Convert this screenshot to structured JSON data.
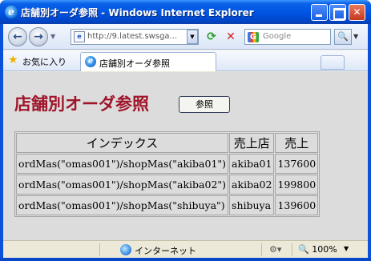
{
  "window": {
    "title": "店舗別オーダ参照 - Windows Internet Explorer"
  },
  "navbar": {
    "address": "http://9.latest.swsga...",
    "search_placeholder": "Google"
  },
  "favorites": {
    "label": "お気に入り"
  },
  "tab": {
    "label": "店舗別オーダ参照"
  },
  "page": {
    "title": "店舗別オーダ参照",
    "view_button": "参照"
  },
  "table": {
    "headers": [
      "インデックス",
      "売上店",
      "売上"
    ],
    "rows": [
      [
        "ordMas(\"omas001\")/shopMas(\"akiba01\")",
        "akiba01",
        "137600"
      ],
      [
        "ordMas(\"omas001\")/shopMas(\"akiba02\")",
        "akiba02",
        "199800"
      ],
      [
        "ordMas(\"omas001\")/shopMas(\"shibuya\")",
        "shibuya",
        "139600"
      ]
    ]
  },
  "statusbar": {
    "zone": "インターネット",
    "zoom": "100%"
  },
  "colors": {
    "title_accent": "#a0142a",
    "titlebar": "#0054e3",
    "content_bg": "#dcdcdc"
  }
}
